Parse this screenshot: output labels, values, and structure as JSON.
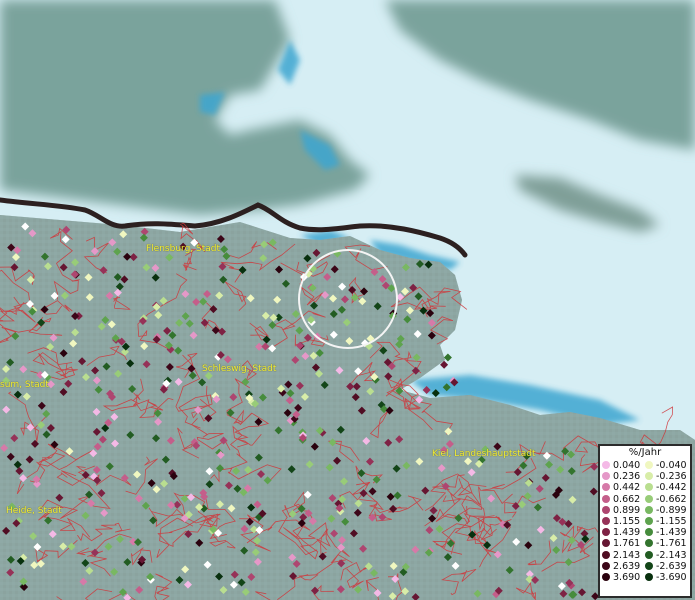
{
  "map": {
    "cities": [
      {
        "id": "flensburg",
        "label": "Flensburg, Stadt"
      },
      {
        "id": "schleswig",
        "label": "Schleswig, Stadt"
      },
      {
        "id": "husum",
        "label": "sum, Stadt"
      },
      {
        "id": "kiel",
        "label": "Kiel, Landeshauptstadt"
      },
      {
        "id": "heide",
        "label": "Heide, Stadt"
      }
    ]
  },
  "legend": {
    "title": "%/Jahr",
    "positive": [
      {
        "label": "0.040",
        "color": "#f4b9e6"
      },
      {
        "label": "0.236",
        "color": "#e598c8"
      },
      {
        "label": "0.442",
        "color": "#d67aa8"
      },
      {
        "label": "0.662",
        "color": "#c45e8a"
      },
      {
        "label": "0.899",
        "color": "#ae4670"
      },
      {
        "label": "1.155",
        "color": "#963258"
      },
      {
        "label": "1.439",
        "color": "#7e2244"
      },
      {
        "label": "1.761",
        "color": "#661632"
      },
      {
        "label": "2.143",
        "color": "#500d23"
      },
      {
        "label": "2.639",
        "color": "#3c0618"
      },
      {
        "label": "3.690",
        "color": "#2a020e"
      }
    ],
    "negative": [
      {
        "label": "-0.040",
        "color": "#f0f7c0"
      },
      {
        "label": "-0.236",
        "color": "#d8eda8"
      },
      {
        "label": "-0.442",
        "color": "#b9de90"
      },
      {
        "label": "-0.662",
        "color": "#98cc78"
      },
      {
        "label": "-0.899",
        "color": "#79b862"
      },
      {
        "label": "-1.155",
        "color": "#5ea34e"
      },
      {
        "label": "-1.439",
        "color": "#468c3c"
      },
      {
        "label": "-1.761",
        "color": "#33742e"
      },
      {
        "label": "-2.143",
        "color": "#225c22"
      },
      {
        "label": "-2.639",
        "color": "#134518"
      },
      {
        "label": "-3.690",
        "color": "#08300e"
      }
    ]
  }
}
